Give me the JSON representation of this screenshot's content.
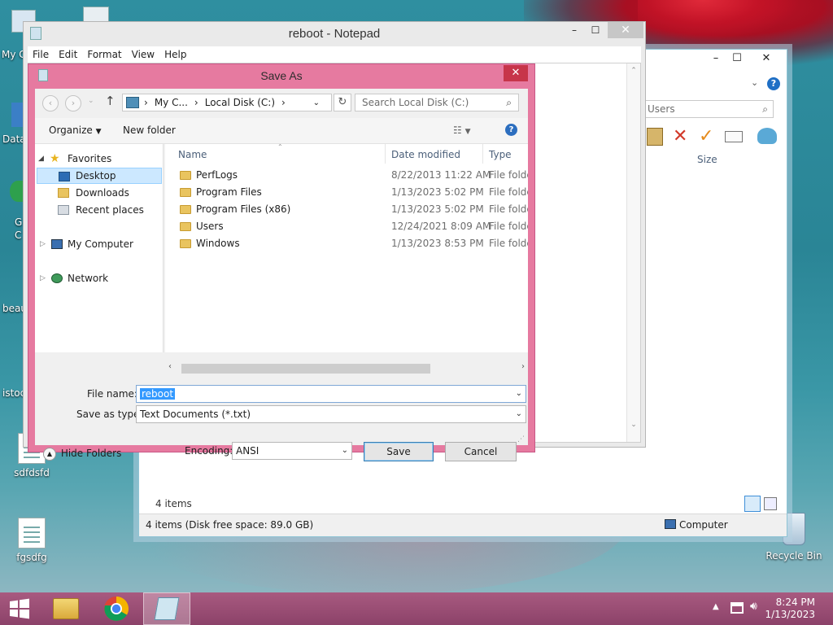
{
  "desktop": {
    "icons": [
      {
        "label": "sdfdsfd"
      },
      {
        "label": "fgsdfg"
      },
      {
        "label": "Recycle Bin"
      }
    ],
    "edge_labels": [
      "My C",
      "Data",
      "G",
      "C",
      "beau",
      "istoc"
    ]
  },
  "explorer": {
    "search_placeholder": "Users",
    "col_size": "Size",
    "items_count": "4 items",
    "status_text": "4 items (Disk free space: 89.0 GB)",
    "status_location": "Computer"
  },
  "notepad": {
    "title": "reboot - Notepad",
    "menu": [
      "File",
      "Edit",
      "Format",
      "View",
      "Help"
    ]
  },
  "save_as": {
    "title": "Save As",
    "breadcrumb": [
      "My C...",
      "Local Disk (C:)"
    ],
    "search_placeholder": "Search Local Disk (C:)",
    "organize_label": "Organize",
    "new_folder_label": "New folder",
    "nav": {
      "favorites": "Favorites",
      "desktop": "Desktop",
      "downloads": "Downloads",
      "recent": "Recent places",
      "computer": "My Computer",
      "network": "Network"
    },
    "columns": {
      "name": "Name",
      "date": "Date modified",
      "type": "Type"
    },
    "files": [
      {
        "name": "PerfLogs",
        "date": "8/22/2013 11:22 AM",
        "type": "File folder"
      },
      {
        "name": "Program Files",
        "date": "1/13/2023 5:02 PM",
        "type": "File folder"
      },
      {
        "name": "Program Files (x86)",
        "date": "1/13/2023 5:02 PM",
        "type": "File folder"
      },
      {
        "name": "Users",
        "date": "12/24/2021 8:09 AM",
        "type": "File folder"
      },
      {
        "name": "Windows",
        "date": "1/13/2023 8:53 PM",
        "type": "File folder"
      }
    ],
    "file_name_label": "File name:",
    "file_name_value": "reboot",
    "save_type_label": "Save as type:",
    "save_type_value": "Text Documents (*.txt)",
    "hide_folders_label": "Hide Folders",
    "encoding_label": "Encoding:",
    "encoding_value": "ANSI",
    "save_label": "Save",
    "cancel_label": "Cancel"
  },
  "taskbar": {
    "time": "8:24 PM",
    "date": "1/13/2023"
  },
  "colors": {
    "dialog_frame": "#e67aa0",
    "selection": "#3399ff",
    "taskbar": "#9a4d73"
  }
}
